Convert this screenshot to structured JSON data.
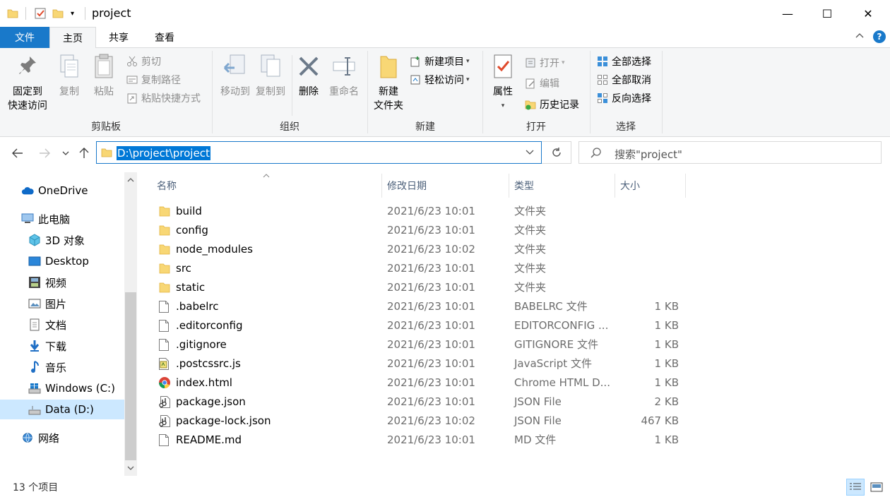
{
  "window": {
    "title": "project",
    "minimize": "—",
    "maximize": "☐",
    "close": "✕"
  },
  "tabs": [
    {
      "label": "文件"
    },
    {
      "label": "主页"
    },
    {
      "label": "共享"
    },
    {
      "label": "查看"
    }
  ],
  "help_label": "?",
  "ribbon": {
    "clipboard": {
      "label": "剪贴板",
      "pin_label_1": "固定到",
      "pin_label_2": "快速访问",
      "copy": "复制",
      "paste": "粘贴",
      "cut": "剪切",
      "copy_path": "复制路径",
      "paste_shortcut": "粘贴快捷方式"
    },
    "organize": {
      "label": "组织",
      "move_to": "移动到",
      "copy_to": "复制到",
      "delete": "删除",
      "rename": "重命名"
    },
    "new": {
      "label": "新建",
      "new_folder_1": "新建",
      "new_folder_2": "文件夹",
      "new_item": "新建项目",
      "easy_access": "轻松访问"
    },
    "open": {
      "label": "打开",
      "properties": "属性",
      "open": "打开",
      "edit": "编辑",
      "history": "历史记录"
    },
    "select": {
      "label": "选择",
      "select_all": "全部选择",
      "select_none": "全部取消",
      "invert": "反向选择"
    }
  },
  "address": {
    "path": "D:\\project\\project"
  },
  "search": {
    "placeholder": "搜索\"project\""
  },
  "nav_pane": {
    "onedrive": "OneDrive",
    "this_pc": "此电脑",
    "objects3d": "3D 对象",
    "desktop": "Desktop",
    "videos": "视频",
    "pictures": "图片",
    "documents": "文档",
    "downloads": "下载",
    "music": "音乐",
    "drive_c": "Windows (C:)",
    "drive_d": "Data (D:)",
    "network": "网络"
  },
  "columns": {
    "name": "名称",
    "modified": "修改日期",
    "type": "类型",
    "size": "大小"
  },
  "files": [
    {
      "name": "build",
      "modified": "2021/6/23 10:01",
      "type": "文件夹",
      "size": "",
      "icon": "folder-icon"
    },
    {
      "name": "config",
      "modified": "2021/6/23 10:01",
      "type": "文件夹",
      "size": "",
      "icon": "folder-icon"
    },
    {
      "name": "node_modules",
      "modified": "2021/6/23 10:02",
      "type": "文件夹",
      "size": "",
      "icon": "folder-icon"
    },
    {
      "name": "src",
      "modified": "2021/6/23 10:01",
      "type": "文件夹",
      "size": "",
      "icon": "folder-icon"
    },
    {
      "name": "static",
      "modified": "2021/6/23 10:01",
      "type": "文件夹",
      "size": "",
      "icon": "folder-icon"
    },
    {
      "name": ".babelrc",
      "modified": "2021/6/23 10:01",
      "type": "BABELRC 文件",
      "size": "1 KB",
      "icon": "file-icon"
    },
    {
      "name": ".editorconfig",
      "modified": "2021/6/23 10:01",
      "type": "EDITORCONFIG ...",
      "size": "1 KB",
      "icon": "file-icon"
    },
    {
      "name": ".gitignore",
      "modified": "2021/6/23 10:01",
      "type": "GITIGNORE 文件",
      "size": "1 KB",
      "icon": "file-icon"
    },
    {
      "name": ".postcssrc.js",
      "modified": "2021/6/23 10:01",
      "type": "JavaScript 文件",
      "size": "1 KB",
      "icon": "js-file-icon"
    },
    {
      "name": "index.html",
      "modified": "2021/6/23 10:01",
      "type": "Chrome HTML D...",
      "size": "1 KB",
      "icon": "chrome-icon"
    },
    {
      "name": "package.json",
      "modified": "2021/6/23 10:01",
      "type": "JSON File",
      "size": "2 KB",
      "icon": "json-file-icon"
    },
    {
      "name": "package-lock.json",
      "modified": "2021/6/23 10:02",
      "type": "JSON File",
      "size": "467 KB",
      "icon": "json-file-icon"
    },
    {
      "name": "README.md",
      "modified": "2021/6/23 10:01",
      "type": "MD 文件",
      "size": "1 KB",
      "icon": "file-icon"
    }
  ],
  "status": {
    "item_count": "13 个项目"
  },
  "colors": {
    "accent": "#1979ca",
    "selection": "#0078d7",
    "folder": "#f8d775",
    "ribbon_bg": "#f5f6f7",
    "nav_selected": "#cce8ff"
  }
}
